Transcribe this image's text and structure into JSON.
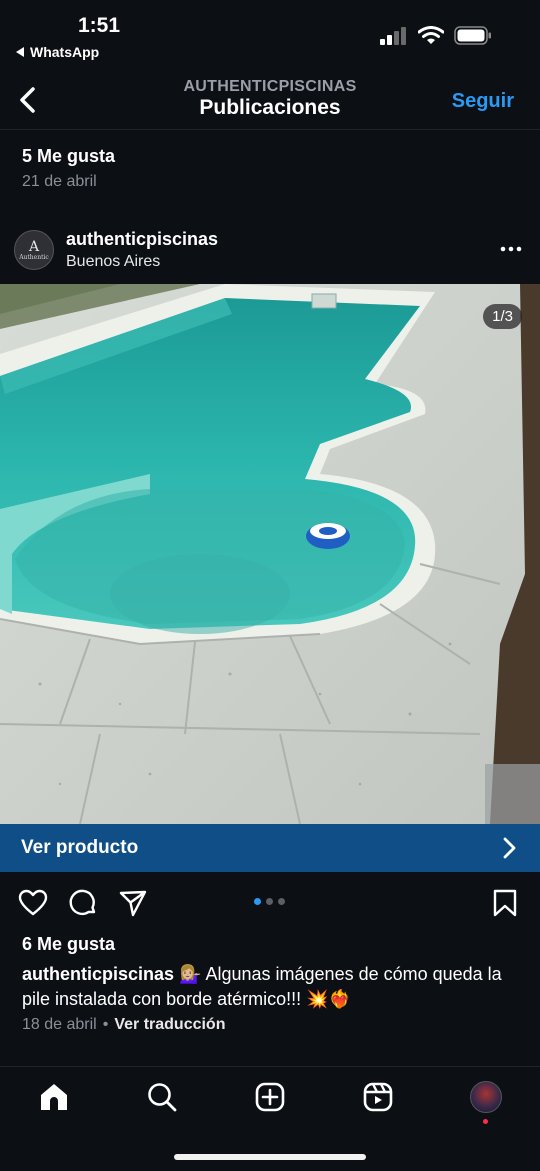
{
  "status": {
    "time": "1:51",
    "back_app": "WhatsApp"
  },
  "nav": {
    "account": "AUTHENTICPISCINAS",
    "title": "Publicaciones",
    "follow": "Seguir"
  },
  "previous_post": {
    "likes": "5 Me gusta",
    "date": "21 de abril"
  },
  "post": {
    "avatar_letter": "A",
    "avatar_text": "Authentic",
    "username": "authenticpiscinas",
    "location": "Buenos Aires",
    "image_counter": "1/3",
    "cta": "Ver producto",
    "likes": "6 Me gusta",
    "caption_user": "authenticpiscinas",
    "caption_text": "💁🏼‍♀️ Algunas imágenes de cómo queda la pile instalada con borde atérmico!!! 💥❤️‍🔥",
    "date": "18 de abril",
    "separator": "•",
    "translate": "Ver traducción",
    "carousel": {
      "total": 3,
      "current": 1
    }
  },
  "colors": {
    "accent": "#2a9af3",
    "cta_bg": "#0f4e86",
    "bg": "#0c0f14"
  },
  "icons": [
    "chevron-left-icon",
    "signal-icon",
    "wifi-icon",
    "battery-icon",
    "more-icon",
    "heart-icon",
    "comment-icon",
    "share-icon",
    "bookmark-icon",
    "home-icon",
    "search-icon",
    "create-icon",
    "reels-icon",
    "profile-icon",
    "chevron-right-icon"
  ]
}
